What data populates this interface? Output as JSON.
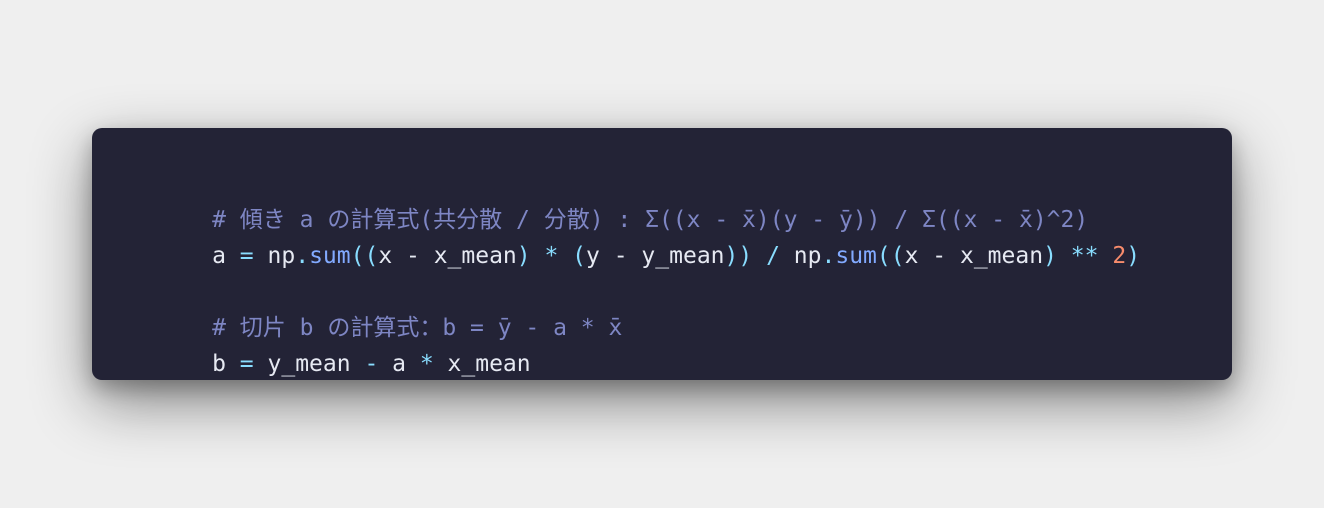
{
  "code": {
    "line1": {
      "comment": "# 傾き a の計算式(共分散 / 分散) : Σ((x - x̄)(y - ȳ)) / Σ((x - x̄)^2)"
    },
    "line2": {
      "t1": "a",
      "t2": " = ",
      "t3": "np",
      "t4": ".",
      "t5": "sum",
      "t6": "((",
      "t7": "x - x_mean",
      "t8": ") * (",
      "t9": "y - y_mean",
      "t10": ")) / ",
      "t11": "np",
      "t12": ".",
      "t13": "sum",
      "t14": "((",
      "t15": "x - x_mean",
      "t16": ") ** ",
      "t17": "2",
      "t18": ")"
    },
    "line3": {
      "blank": ""
    },
    "line4": {
      "comment": "# 切片 b の計算式：b = ȳ - a * x̄"
    },
    "line5": {
      "t1": "b",
      "t2": " = ",
      "t3": "y_mean",
      "t4": " - ",
      "t5": "a",
      "t6": " * ",
      "t7": "x_mean"
    }
  }
}
